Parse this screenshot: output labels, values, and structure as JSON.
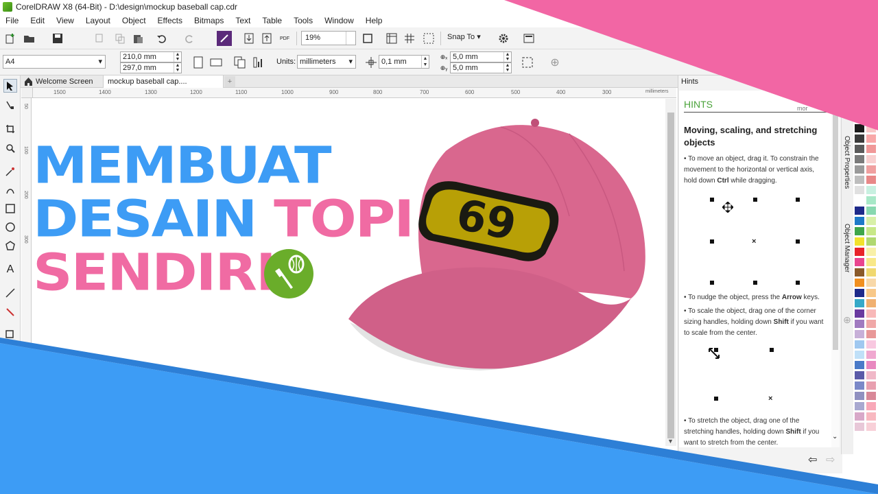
{
  "window": {
    "title": "CorelDRAW X8 (64-Bit) - D:\\design\\mockup baseball cap.cdr"
  },
  "menu": [
    "File",
    "Edit",
    "View",
    "Layout",
    "Object",
    "Effects",
    "Bitmaps",
    "Text",
    "Table",
    "Tools",
    "Window",
    "Help"
  ],
  "toolbar": {
    "zoom_value": "19%",
    "snap_label": "Snap To"
  },
  "property_bar": {
    "page_size": "A4",
    "width": "210,0 mm",
    "height": "297,0 mm",
    "units_label": "Units:",
    "units_value": "millimeters",
    "nudge": "0,1 mm",
    "dup_x": "5,0 mm",
    "dup_y": "5,0 mm"
  },
  "tabs": {
    "welcome": "Welcome Screen",
    "document": "mockup baseball cap...."
  },
  "ruler": {
    "ticks": [
      "1500",
      "1400",
      "1300",
      "1200",
      "1100",
      "1000",
      "900",
      "800",
      "700",
      "600",
      "500",
      "400",
      "300"
    ],
    "unit": "millimeters",
    "v_ticks": [
      "50",
      "100",
      "200",
      "300"
    ]
  },
  "artwork": {
    "line1": "MEMBUAT",
    "line2a": "DESAIN",
    "line2b": "TOPI",
    "line3": "SENDIRI",
    "patch_number": "69",
    "colors": {
      "blue": "#3d9cf5",
      "pink": "#f06ba3",
      "cap": "#d9678e",
      "logo_green": "#6aad2a",
      "patch_yellow": "#b8a006"
    }
  },
  "hints": {
    "panel_title": "Hints",
    "heading": "HINTS",
    "more": "mor",
    "subtitle": "Moving, scaling, and stretching objects",
    "p1_a": "• To move an object, drag it. To constrain the movement to the horizontal or vertical axis, hold down ",
    "p1_key": "Ctrl",
    "p1_b": " while dragging.",
    "p2_a": "• To nudge the object, press the ",
    "p2_key": "Arrow",
    "p2_b": " keys.",
    "p3_a": "• To scale the object, drag one of the corner sizing handles, holding down ",
    "p3_key": "Shift",
    "p3_b": " if you want to scale from the center.",
    "p4_a": "• To stretch the object, drag one of the stretching handles, holding down ",
    "p4_key": "Shift",
    "p4_b": " if you want to stretch from the center."
  },
  "docker_tabs": [
    "Object Properties",
    "Object Manager"
  ],
  "palette_colors": [
    "#1a1a1a",
    "#3a3a3a",
    "#5a5a5a",
    "#7a7a7a",
    "#9a9a9a",
    "#bdbdbd",
    "#e0e0e0",
    "#ffffff",
    "#1e2a8a",
    "#1e7ac8",
    "#3fa64a",
    "#f2e12c",
    "#e8232a",
    "#e9458f",
    "#8a5a2a",
    "#f19020",
    "#1e2a8a",
    "#36a9c8",
    "#6a3aa0",
    "#a07ac0",
    "#c7b0d8",
    "#a0c8f0",
    "#c0e0f8",
    "#4a7ac8",
    "#5a5aa8",
    "#7a88c8",
    "#9090c0",
    "#a8a8d0",
    "#d8a8c8",
    "#e8c8d8"
  ],
  "palette_colors_right": [
    "#f8c8c8",
    "#f8a8a8",
    "#f09898",
    "#f8d0d0",
    "#f0a0a0",
    "#e88888",
    "#c8f0e0",
    "#a8e8c8",
    "#88d8b0",
    "#d8f0a8",
    "#c8e888",
    "#b0d870",
    "#f8f0a8",
    "#f8e888",
    "#f0d870",
    "#f8d8a8",
    "#f8c888",
    "#f0b070",
    "#f8b8b8",
    "#f0a8a8",
    "#e89898",
    "#f8c8e0",
    "#f0a8d0",
    "#e888c0",
    "#f0b8c8",
    "#e8a0b0",
    "#d88898",
    "#f8a8b8",
    "#f8b8c0",
    "#f8d0d8"
  ]
}
